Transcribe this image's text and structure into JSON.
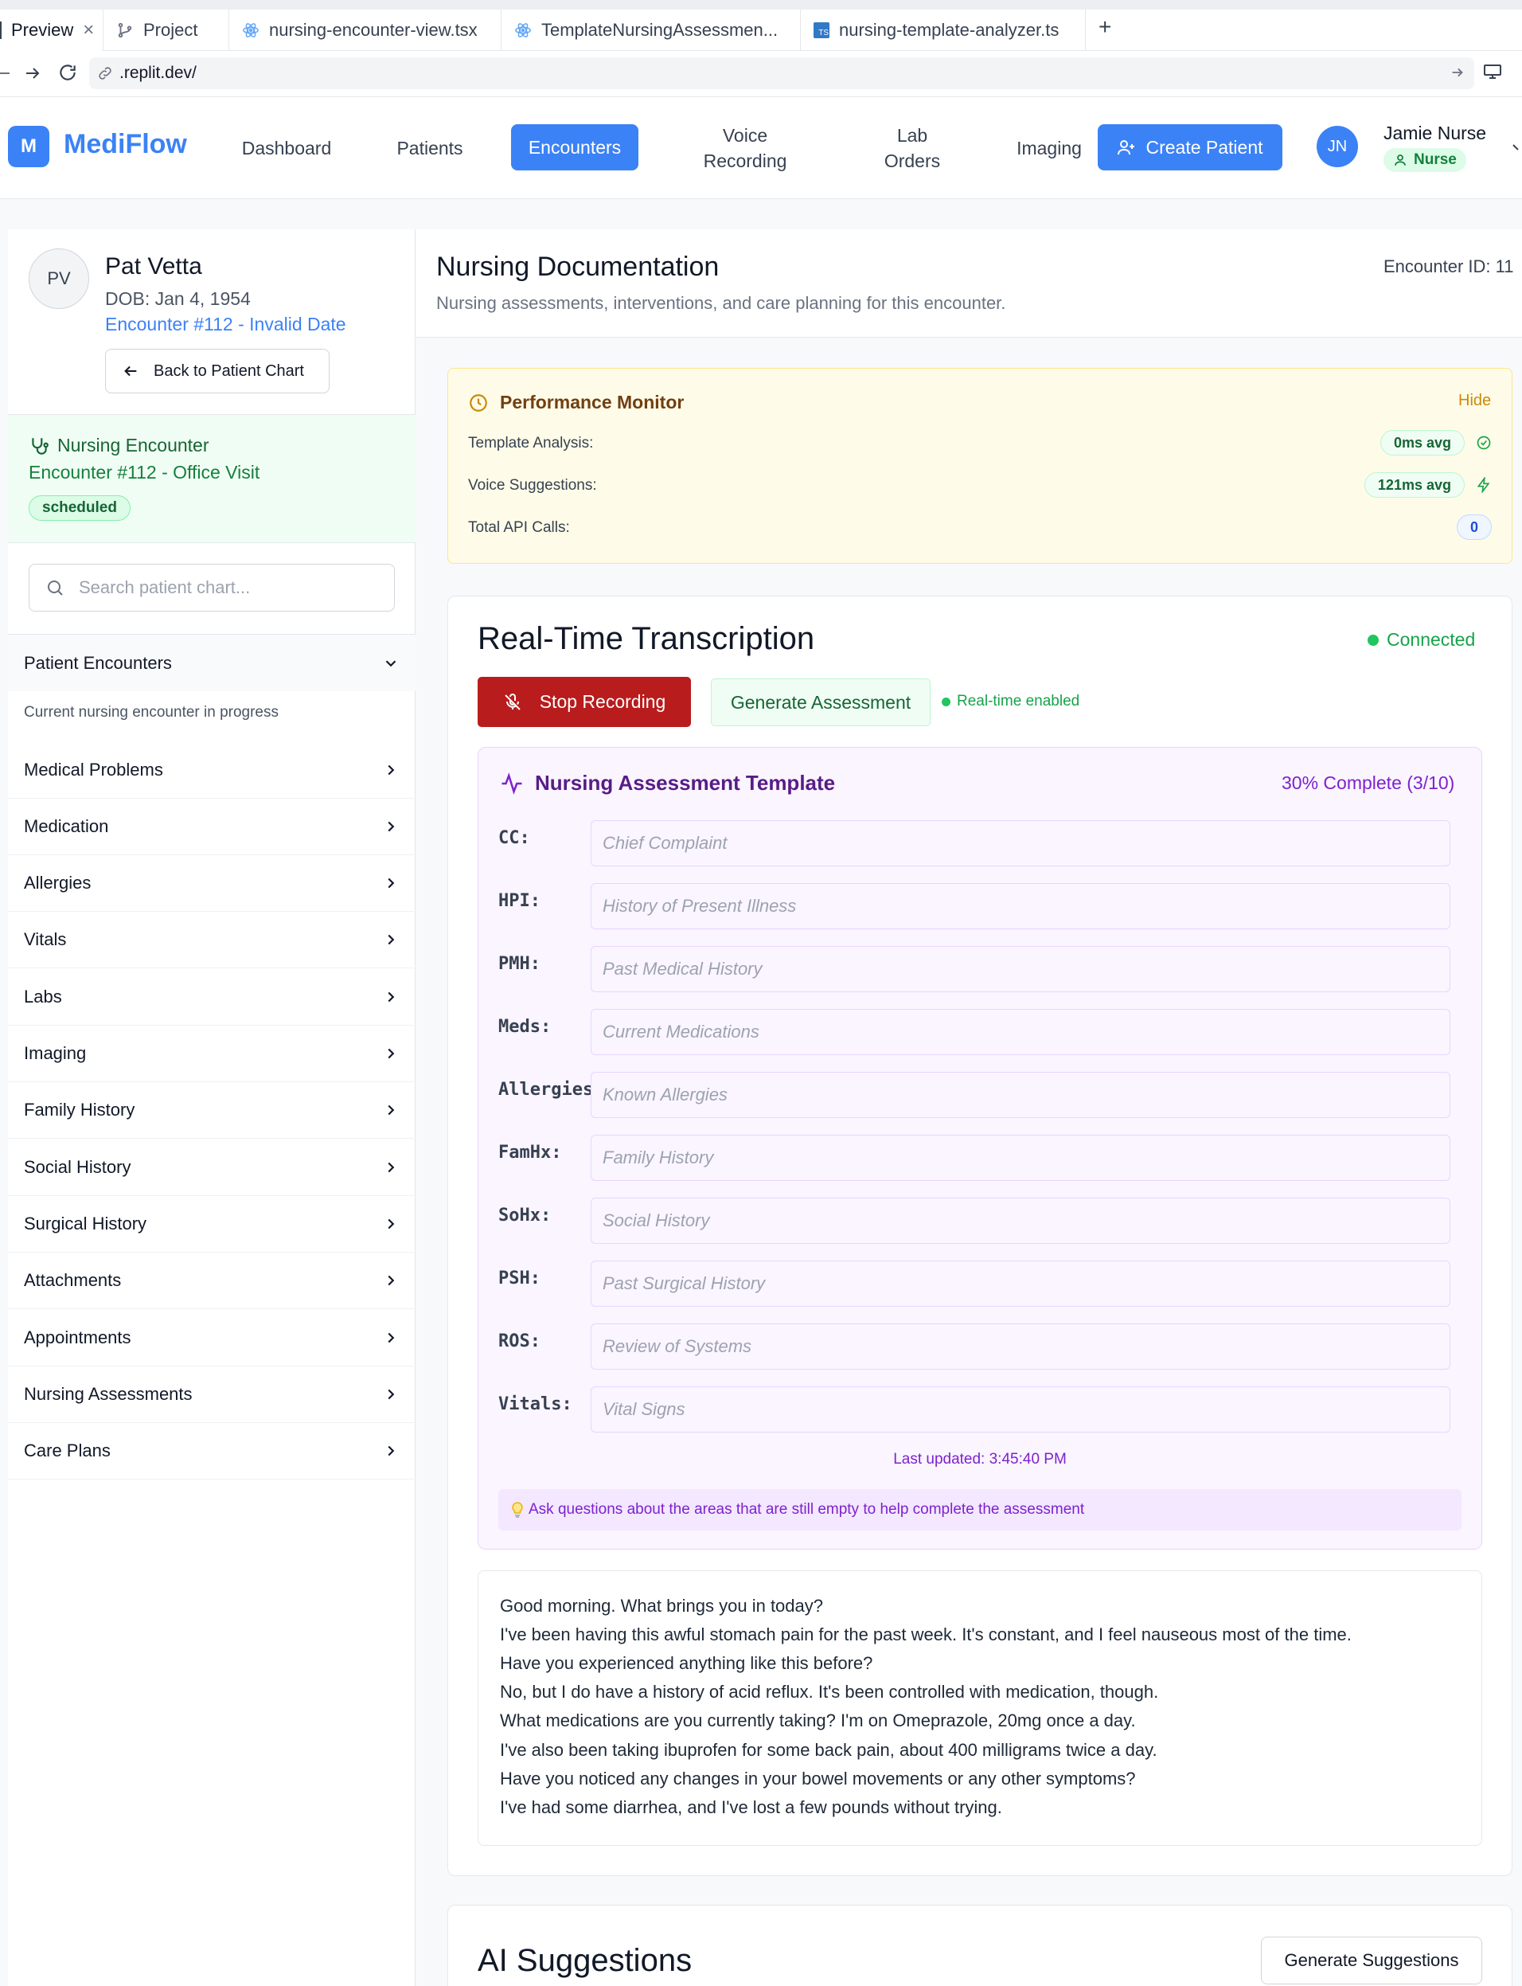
{
  "browser": {
    "tabs": [
      {
        "label": "Preview"
      },
      {
        "label": "Project"
      },
      {
        "label": "nursing-encounter-view.tsx"
      },
      {
        "label": "TemplateNursingAssessmen..."
      },
      {
        "label": "nursing-template-analyzer.ts"
      }
    ],
    "url": ".replit.dev/",
    "new_tab": "+",
    "close": "×"
  },
  "app": {
    "logo_letter": "M",
    "brand": "MediFlow",
    "nav": [
      {
        "label": "Dashboard"
      },
      {
        "label": "Patients"
      },
      {
        "label": "Encounters"
      },
      {
        "label": "Voice\nRecording"
      },
      {
        "label": "Lab\nOrders"
      },
      {
        "label": "Imaging"
      }
    ],
    "create_patient": "Create Patient",
    "user": {
      "initials": "JN",
      "name": "Jamie Nurse",
      "role": "Nurse"
    },
    "accent": "#3b82f6"
  },
  "patient": {
    "initials": "PV",
    "name": "Pat Vetta",
    "dob": "DOB: Jan 4, 1954",
    "encounter_link": "Encounter #112 - Invalid Date",
    "back_button": "Back to Patient Chart"
  },
  "encounter_card": {
    "title": "Nursing Encounter",
    "subtitle": "Encounter #112 - Office Visit",
    "status": "scheduled"
  },
  "sidebar": {
    "search_placeholder": "Search patient chart...",
    "expanded_section": "Patient Encounters",
    "expanded_text": "Current nursing encounter in progress",
    "sections": [
      {
        "label": "Medical Problems"
      },
      {
        "label": "Medication"
      },
      {
        "label": "Allergies"
      },
      {
        "label": "Vitals"
      },
      {
        "label": "Labs"
      },
      {
        "label": "Imaging"
      },
      {
        "label": "Family History"
      },
      {
        "label": "Social History"
      },
      {
        "label": "Surgical History"
      },
      {
        "label": "Attachments"
      },
      {
        "label": "Appointments"
      },
      {
        "label": "Nursing Assessments"
      },
      {
        "label": "Care Plans"
      }
    ]
  },
  "main": {
    "title": "Nursing Documentation",
    "subtitle": "Nursing assessments, interventions, and care planning for this encounter.",
    "encounter_id": "Encounter ID: 11"
  },
  "performance": {
    "title": "Performance Monitor",
    "hide": "Hide",
    "rows": [
      {
        "label": "Template Analysis:",
        "value": "0ms avg"
      },
      {
        "label": "Voice Suggestions:",
        "value": "121ms avg"
      },
      {
        "label": "Total API Calls:",
        "value": "0"
      }
    ]
  },
  "transcription": {
    "title": "Real-Time Transcription",
    "status": "Connected",
    "stop_button": "Stop Recording",
    "generate_button": "Generate Assessment",
    "realtime": "Real-time enabled",
    "status_color": "#16a34a"
  },
  "template": {
    "title": "Nursing Assessment Template",
    "progress": "30% Complete (3/10)",
    "fields": [
      {
        "label": "CC:",
        "placeholder": "Chief Complaint"
      },
      {
        "label": "HPI:",
        "placeholder": "History of Present Illness"
      },
      {
        "label": "PMH:",
        "placeholder": "Past Medical History"
      },
      {
        "label": "Meds:",
        "placeholder": "Current Medications"
      },
      {
        "label": "Allergies:",
        "placeholder": "Known Allergies"
      },
      {
        "label": "FamHx:",
        "placeholder": "Family History"
      },
      {
        "label": "SoHx:",
        "placeholder": "Social History"
      },
      {
        "label": "PSH:",
        "placeholder": "Past Surgical History"
      },
      {
        "label": "ROS:",
        "placeholder": "Review of Systems"
      },
      {
        "label": "Vitals:",
        "placeholder": "Vital Signs"
      }
    ],
    "last_updated": "Last updated: 3:45:40 PM",
    "tip": "Ask questions about the areas that are still empty to help complete the assessment"
  },
  "transcript": [
    "Good morning. What brings you in today?",
    "I've been having this awful stomach pain for the past week. It's constant, and I feel nauseous most of the time.",
    "Have you experienced anything like this before?",
    "No, but I do have a history of acid reflux. It's been controlled with medication, though.",
    "What medications are you currently taking? I'm on Omeprazole, 20mg once a day.",
    "I've also been taking ibuprofen for some back pain, about 400 milligrams twice a day.",
    "Have you noticed any changes in your bowel movements or any other symptoms?",
    "I've had some diarrhea, and I've lost a few pounds without trying."
  ],
  "ai": {
    "title": "AI Suggestions",
    "button": "Generate Suggestions"
  }
}
